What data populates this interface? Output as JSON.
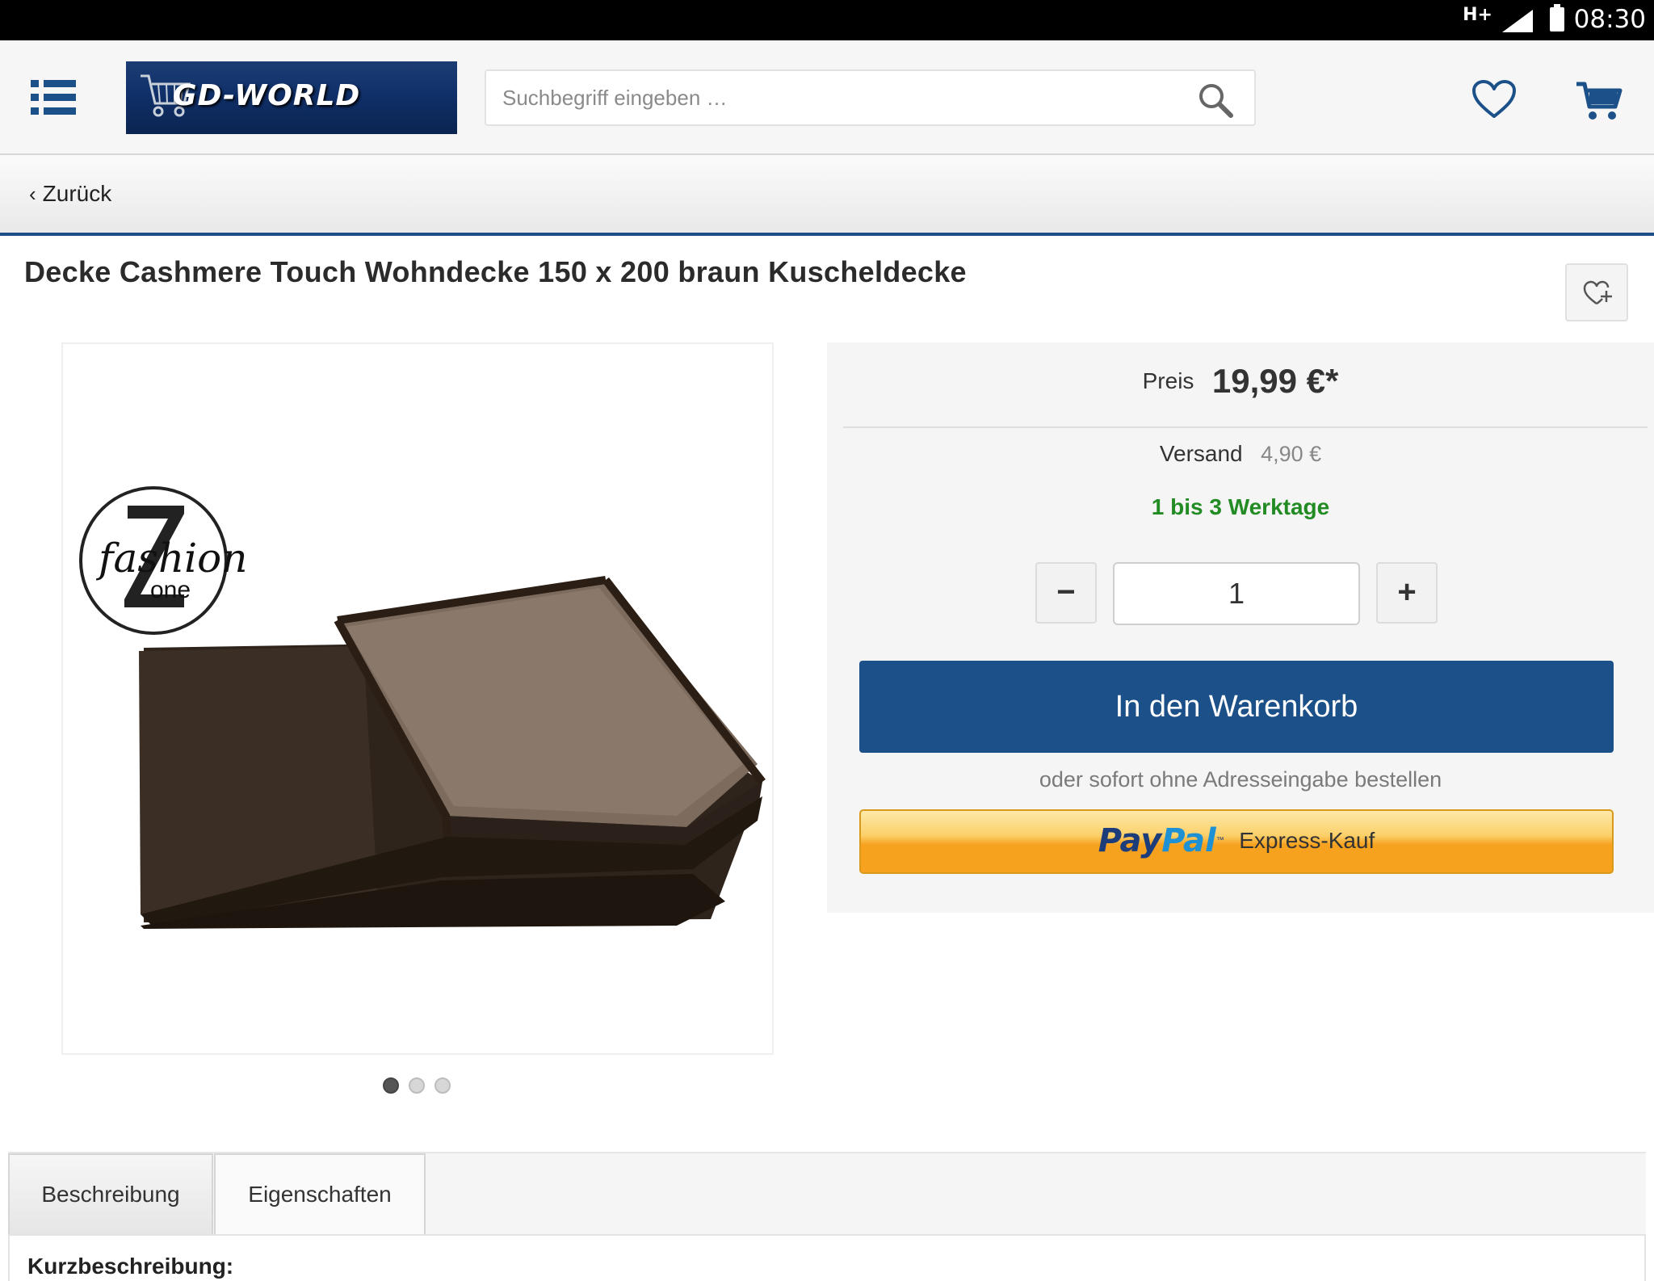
{
  "status_bar": {
    "network": "H+",
    "time": "08:30"
  },
  "header": {
    "logo_text": "GD-WORLD",
    "search_placeholder": "Suchbegriff eingeben …"
  },
  "nav": {
    "back_label": "Zurück"
  },
  "product": {
    "title": "Decke Cashmere Touch Wohndecke 150 x 200 braun Kuscheldecke",
    "image_brand_top": "fashion",
    "image_brand_bottom": "one",
    "image_count": 3,
    "active_image_index": 0
  },
  "buybox": {
    "price_label": "Preis",
    "price_value": "19,99 €*",
    "shipping_label": "Versand",
    "shipping_value": "4,90 €",
    "delivery_time": "1 bis 3 Werktage",
    "qty_minus": "−",
    "qty_value": "1",
    "qty_plus": "+",
    "add_to_cart": "In den Warenkorb",
    "or_text": "oder sofort ohne Adresseingabe bestellen",
    "paypal_pay": "Pay",
    "paypal_pal": "Pal",
    "paypal_tm": "™",
    "paypal_text": "Express-Kauf"
  },
  "tabs": {
    "description": "Beschreibung",
    "properties": "Eigenschaften"
  },
  "content": {
    "short_description_heading": "Kurzbeschreibung:"
  },
  "colors": {
    "primary_blue": "#1b5088",
    "delivery_green": "#238b23",
    "paypal_orange": "#f7a21f"
  }
}
